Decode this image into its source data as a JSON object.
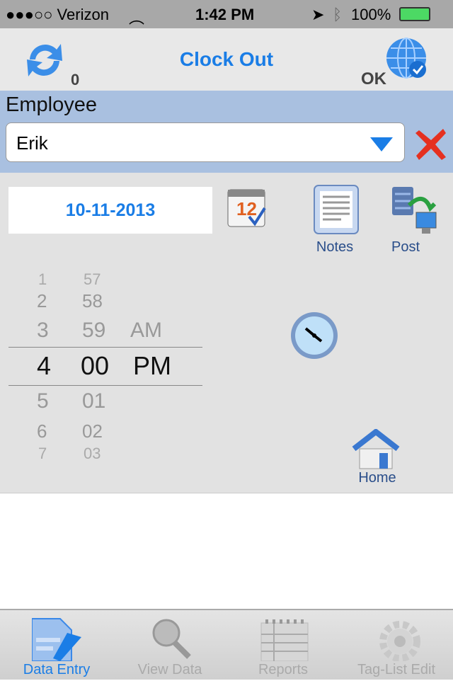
{
  "status": {
    "carrier": "●●●○○ Verizon",
    "time": "1:42 PM",
    "battery": "100%"
  },
  "nav": {
    "title": "Clock Out",
    "sync_count": "0",
    "connection": "OK"
  },
  "employee": {
    "label": "Employee",
    "value": "Erik"
  },
  "date": "10-11-2013",
  "actions": {
    "notes": "Notes",
    "post": "Post",
    "home": "Home"
  },
  "picker": {
    "rows": [
      [
        "1",
        "57",
        ""
      ],
      [
        "2",
        "58",
        ""
      ],
      [
        "3",
        "59",
        "AM"
      ],
      [
        "4",
        "00",
        "PM"
      ],
      [
        "5",
        "01",
        ""
      ],
      [
        "6",
        "02",
        ""
      ],
      [
        "7",
        "03",
        ""
      ]
    ],
    "selected_index": 3
  },
  "tabs": [
    {
      "label": "Data Entry",
      "active": true
    },
    {
      "label": "View Data"
    },
    {
      "label": "Reports"
    },
    {
      "label": "Tag-List Edit"
    }
  ],
  "colors": {
    "accent": "#1a7de6",
    "employee_band": "#a9c0e0"
  }
}
